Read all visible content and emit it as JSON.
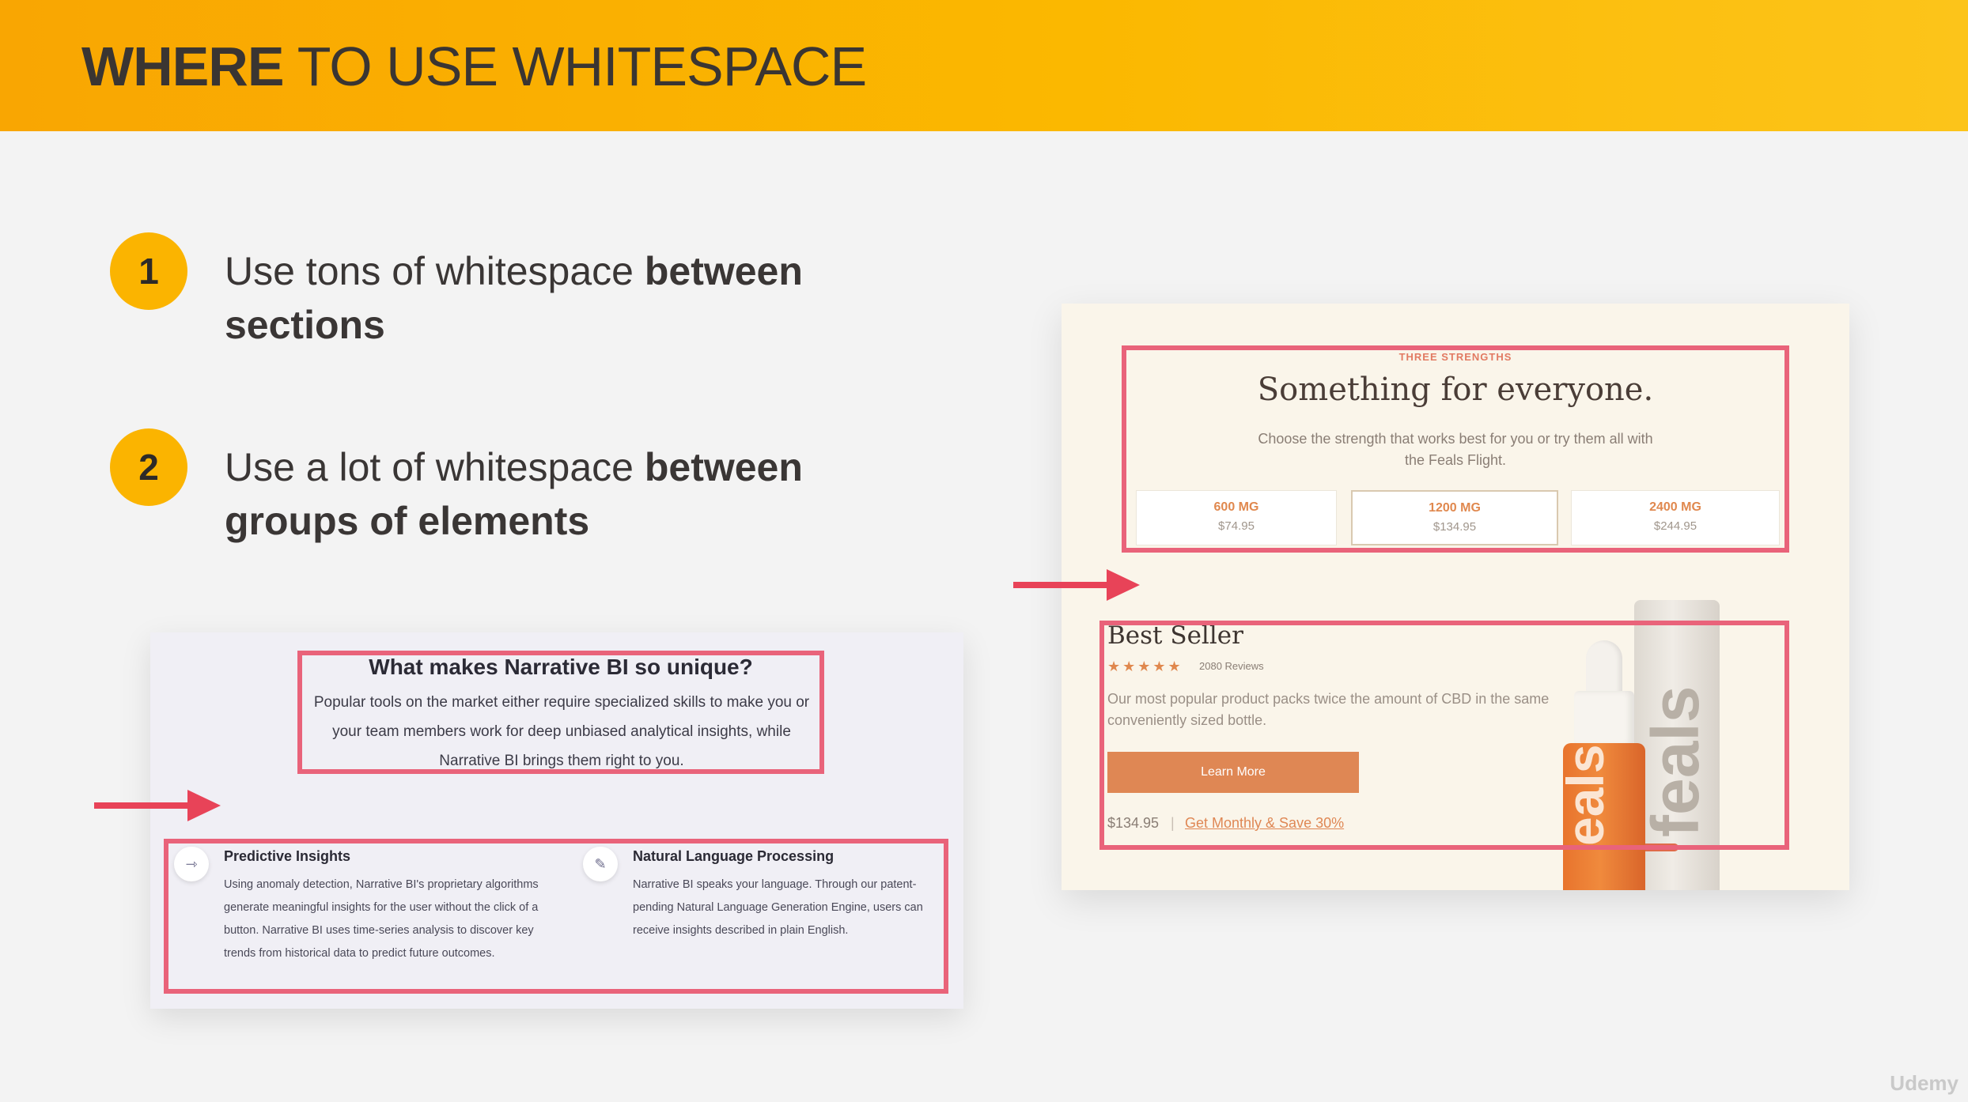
{
  "header": {
    "title_bold": "WHERE",
    "title_rest": " TO USE WHITESPACE"
  },
  "points": [
    {
      "number": "1",
      "text": "Use tons of whitespace ",
      "bold": "between sections"
    },
    {
      "number": "2",
      "text": "Use a lot of whitespace ",
      "bold": "between groups of elements"
    }
  ],
  "narrative_bi": {
    "title": "What makes Narrative BI so unique?",
    "description": "Popular tools on the market either require specialized skills to make you or your team members work for deep unbiased analytical insights, while Narrative BI brings them right to you.",
    "features": [
      {
        "icon": "arrow-right-circle-icon",
        "title": "Predictive Insights",
        "description": "Using anomaly detection, Narrative BI's proprietary algorithms generate meaningful insights for the user without the click of a button. Narrative BI uses time-series analysis to discover key trends from historical data to predict future outcomes."
      },
      {
        "icon": "pencil-icon",
        "title": "Natural Language Processing",
        "description": "Narrative BI speaks your language. Through our patent-pending Natural Language Generation Engine, users can receive insights described in plain English."
      }
    ]
  },
  "feals": {
    "eyebrow": "THREE STRENGTHS",
    "title": "Something for everyone.",
    "subtitle": "Choose the strength that works best for you or try them all with the Feals Flight.",
    "options": [
      {
        "mg": "600 MG",
        "price": "$74.95"
      },
      {
        "mg": "1200 MG",
        "price": "$134.95"
      },
      {
        "mg": "2400 MG",
        "price": "$244.95"
      }
    ],
    "best_seller": {
      "title": "Best Seller",
      "stars": "★★★★★",
      "rating": 5,
      "reviews": "2080 Reviews",
      "description": "Our most popular product packs twice the amount of CBD in the same conveniently sized bottle.",
      "button": "Learn More",
      "price": "$134.95",
      "separator": "|",
      "link": "Get Monthly & Save 30%"
    },
    "product": {
      "bottle_text": "eals",
      "box_text": "feals"
    }
  },
  "watermark": "Udemy",
  "colors": {
    "header": "#fbb400",
    "highlight": "#e9637a",
    "arrow": "#e84358",
    "feals_accent": "#df8754"
  }
}
